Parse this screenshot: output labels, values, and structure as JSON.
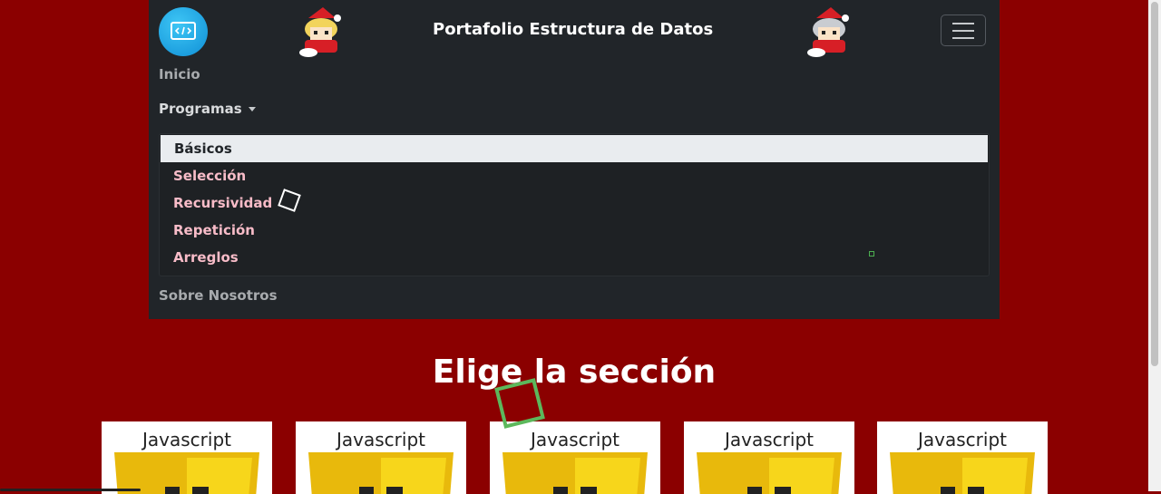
{
  "navbar": {
    "brand_title": "Portafolio Estructura de Datos",
    "logo_icon": "code-icon",
    "links": {
      "inicio": "Inicio",
      "programas": "Programas",
      "sobre_nosotros": "Sobre Nosotros"
    },
    "dropdown_items": [
      "Básicos",
      "Selección",
      "Recursividad",
      "Repetición",
      "Arreglos"
    ],
    "active_item": "Básicos"
  },
  "main": {
    "section_title": "Elige la sección",
    "cards": [
      {
        "label": "Javascript"
      },
      {
        "label": "Javascript"
      },
      {
        "label": "Javascript"
      },
      {
        "label": "Javascript"
      },
      {
        "label": "Javascript"
      }
    ]
  },
  "colors": {
    "page_background": "#8b0000",
    "navbar_background": "#212529",
    "dropdown_link": "#f8bcc8",
    "js_yellow": "#f0db4f"
  }
}
